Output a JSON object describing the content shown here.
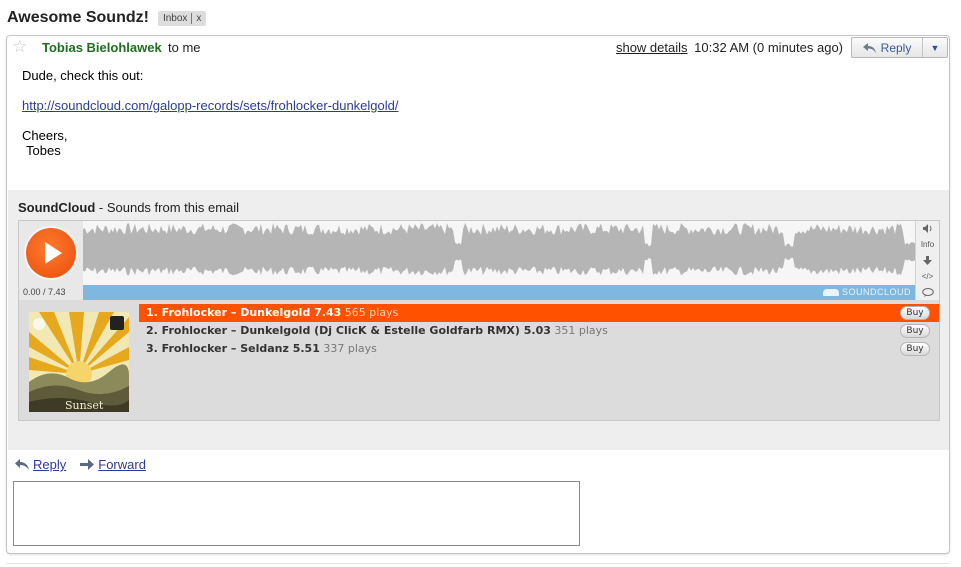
{
  "subject": "Awesome Soundz!",
  "label": {
    "name": "Inbox",
    "remove": "x"
  },
  "message": {
    "sender": "Tobias Bielohlawek",
    "to_text": "to me",
    "show_details": "show details",
    "timestamp": "10:32 AM (0 minutes ago)",
    "reply_button": "Reply",
    "body_line1": "Dude, check this out:",
    "link": "http://soundcloud.com/galopp-records/sets/frohlocker-dunkelgold/",
    "signoff": "Cheers,",
    "signature": "Tobes"
  },
  "soundcloud": {
    "title": "SoundCloud",
    "subtitle": "- Sounds from this email",
    "time": "0.00 / 7.43",
    "brand": "SOUNDCLOUD",
    "tools": [
      "volume-icon",
      "Info",
      "download-icon",
      "embed-icon",
      "comment-icon"
    ],
    "info_label": "Info",
    "embed_label": "</>",
    "accent": "#ff5100",
    "tracks": [
      {
        "label": "1. Frohlocker – Dunkelgold 7.43",
        "plays": "565 plays",
        "buy": "Buy"
      },
      {
        "label": "2. Frohlocker – Dunkelgold (Dj ClicK & Estelle Goldfarb RMX) 5.03",
        "plays": "351 plays",
        "buy": "Buy"
      },
      {
        "label": "3. Frohlocker – Seldanz 5.51",
        "plays": "337 plays",
        "buy": "Buy"
      }
    ]
  },
  "actions": {
    "reply": "Reply",
    "forward": "Forward"
  },
  "colors": {
    "sender": "#1f6f1f",
    "link": "#2a3c99",
    "waveform_bar": "#7fb8df"
  }
}
